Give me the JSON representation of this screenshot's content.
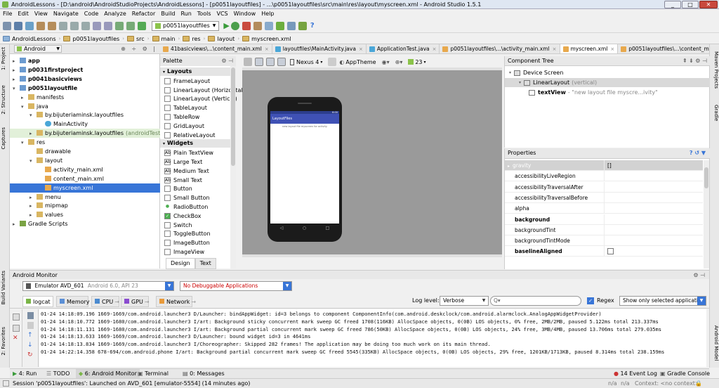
{
  "window": {
    "title": "AndroidLessons - [D:\\android\\AndroidStudioProjects\\AndroidLessons] - [p0051layoutfiles] - ...\\p0051layoutfiles\\src\\main\\res\\layout\\myscreen.xml - Android Studio 1.5.1"
  },
  "menu": [
    "File",
    "Edit",
    "View",
    "Navigate",
    "Code",
    "Analyze",
    "Refactor",
    "Build",
    "Run",
    "Tools",
    "VCS",
    "Window",
    "Help"
  ],
  "toolbar": {
    "run_config": "p0051layoutfiles"
  },
  "breadcrumbs": [
    "AndroidLessons",
    "p0051layoutfiles",
    "src",
    "main",
    "res",
    "layout",
    "myscreen.xml"
  ],
  "left_strip": [
    "1: Project",
    "2: Structure",
    "Captures",
    "Build Variants",
    "2: Favorites"
  ],
  "right_strip": [
    "Maven Projects",
    "Gradle",
    "Android Model"
  ],
  "project": {
    "view": "Android",
    "tree": [
      {
        "label": "app",
        "depth": 0,
        "arrow": "▸",
        "icon": "module",
        "bold": true
      },
      {
        "label": "p0031firstproject",
        "depth": 0,
        "arrow": "▸",
        "icon": "module",
        "bold": true
      },
      {
        "label": "p0041basicviews",
        "depth": 0,
        "arrow": "▸",
        "icon": "module",
        "bold": true
      },
      {
        "label": "p0051layoutfile",
        "depth": 0,
        "arrow": "▾",
        "icon": "module",
        "bold": true
      },
      {
        "label": "manifests",
        "depth": 1,
        "arrow": "▸",
        "icon": "folder"
      },
      {
        "label": "java",
        "depth": 1,
        "arrow": "▾",
        "icon": "folder"
      },
      {
        "label": "by.bijuteriaminsk.layoutfiles",
        "depth": 2,
        "arrow": "▾",
        "icon": "package"
      },
      {
        "label": "MainActivity",
        "depth": 3,
        "arrow": "",
        "icon": "class"
      },
      {
        "label": "by.bijuteriaminsk.layoutfiles",
        "suffix": "(androidTest)",
        "depth": 2,
        "arrow": "▸",
        "icon": "package",
        "highlight": true
      },
      {
        "label": "res",
        "depth": 1,
        "arrow": "▾",
        "icon": "folder"
      },
      {
        "label": "drawable",
        "depth": 2,
        "arrow": "",
        "icon": "folder"
      },
      {
        "label": "layout",
        "depth": 2,
        "arrow": "▾",
        "icon": "folder"
      },
      {
        "label": "activity_main.xml",
        "depth": 3,
        "arrow": "",
        "icon": "xml"
      },
      {
        "label": "content_main.xml",
        "depth": 3,
        "arrow": "",
        "icon": "xml"
      },
      {
        "label": "myscreen.xml",
        "depth": 3,
        "arrow": "",
        "icon": "xml",
        "selected": true
      },
      {
        "label": "menu",
        "depth": 2,
        "arrow": "▸",
        "icon": "folder"
      },
      {
        "label": "mipmap",
        "depth": 2,
        "arrow": "▸",
        "icon": "folder"
      },
      {
        "label": "values",
        "depth": 2,
        "arrow": "▸",
        "icon": "folder"
      },
      {
        "label": "Gradle Scripts",
        "depth": 0,
        "arrow": "▸",
        "icon": "gradle"
      }
    ]
  },
  "editor_tabs": [
    {
      "label": "41basicviews\\...\\content_main.xml"
    },
    {
      "label": "layoutfiles\\MainActivity.java"
    },
    {
      "label": "ApplicationTest.java"
    },
    {
      "label": "p0051layoutfiles\\...\\activity_main.xml"
    },
    {
      "label": "myscreen.xml",
      "active": true
    },
    {
      "label": "p0051layoutfiles\\...\\content_main.xml"
    }
  ],
  "palette": {
    "title": "Palette",
    "groups": [
      {
        "name": "Layouts",
        "items": [
          "FrameLayout",
          "LinearLayout (Horizontal)",
          "LinearLayout (Vertical)",
          "TableLayout",
          "TableRow",
          "GridLayout",
          "RelativeLayout"
        ]
      },
      {
        "name": "Widgets",
        "items": [
          "Plain TextView",
          "Large Text",
          "Medium Text",
          "Small Text",
          "Button",
          "Small Button",
          "RadioButton",
          "CheckBox",
          "Switch",
          "ToggleButton",
          "ImageButton",
          "ImageView"
        ]
      }
    ]
  },
  "design_toolbar": {
    "device": "Nexus 4",
    "theme": "AppTheme",
    "api": "23"
  },
  "preview": {
    "app_title": "LayoutFiles",
    "time": "6:00",
    "text": "new layout file myscreen for activity"
  },
  "design_tabs": [
    "Design",
    "Text"
  ],
  "component_tree": {
    "title": "Component Tree",
    "items": [
      {
        "label": "Device Screen",
        "depth": 0
      },
      {
        "label": "LinearLayout",
        "suffix": "(vertical)",
        "depth": 1,
        "selected": true
      },
      {
        "label": "textView",
        "suffix": "- \"new layout file myscre...ivity\"",
        "depth": 2,
        "bold": true
      }
    ]
  },
  "properties": {
    "title": "Properties",
    "rows": [
      {
        "name": "gravity",
        "value": "[]",
        "group": true
      },
      {
        "name": "accessibilityLiveRegion"
      },
      {
        "name": "accessibilityTraversalAfter"
      },
      {
        "name": "accessibilityTraversalBefore"
      },
      {
        "name": "alpha"
      },
      {
        "name": "background",
        "bold": true
      },
      {
        "name": "backgroundTint"
      },
      {
        "name": "backgroundTintMode"
      },
      {
        "name": "baselineAligned",
        "bold": true,
        "checkbox": true
      }
    ]
  },
  "monitor": {
    "title": "Android Monitor",
    "device": "Emulator AVD_601",
    "device_sub": "Android 6.0, API 23",
    "app": "No Debuggable Applications",
    "tabs": [
      "logcat",
      "Memory",
      "CPU",
      "GPU",
      "Network"
    ],
    "log_level_label": "Log level:",
    "log_level": "Verbose",
    "search_placeholder": "Q▾",
    "regex_label": "Regex",
    "filter": "Show only selected application",
    "log": [
      "01-24 14:18:09.196 1669-1669/com.android.launcher3 D/Launcher: bindAppWidget: id=3 belongs to component ComponentInfo(com.android.deskclock/com.android.alarmclock.AnalogAppWidgetProvider)",
      "01-24 14:18:10.772 1669-1680/com.android.launcher3 I/art: Background sticky concurrent mark sweep GC freed 1708(116KB) AllocSpace objects, 0(0B) LOS objects, 0% free, 2MB/2MB, paused 5.122ms total 213.337ms",
      "01-24 14:18:11.131 1669-1680/com.android.launcher3 I/art: Background partial concurrent mark sweep GC freed 786(50KB) AllocSpace objects, 0(0B) LOS objects, 24% free, 3MB/4MB, paused 13.706ms total 279.035ms",
      "01-24 14:18:13.633 1669-1669/com.android.launcher3 D/Launcher: bound widget id=3 in 4641ms",
      "01-24 14:18:13.834 1669-1669/com.android.launcher3 I/Choreographer: Skipped 282 frames!  The application may be doing too much work on its main thread.",
      "01-24 14:22:14.358 678-694/com.android.phone I/art: Background partial concurrent mark sweep GC freed 5545(335KB) AllocSpace objects, 0(0B) LOS objects, 29% free, 1201KB/1713KB, paused 8.314ms total 238.159ms"
    ]
  },
  "bottom_tabs": [
    "4: Run",
    "TODO",
    "6: Android Monitor",
    "Terminal",
    "0: Messages"
  ],
  "bottom_right": [
    "14 Event Log",
    "Gradle Console"
  ],
  "status": {
    "text": "Session 'p0051layoutfiles': Launched on AVD_601 [emulator-5554] (14 minutes ago)",
    "na1": "n/a",
    "na2": "n/a",
    "context": "Context: <no context>"
  }
}
